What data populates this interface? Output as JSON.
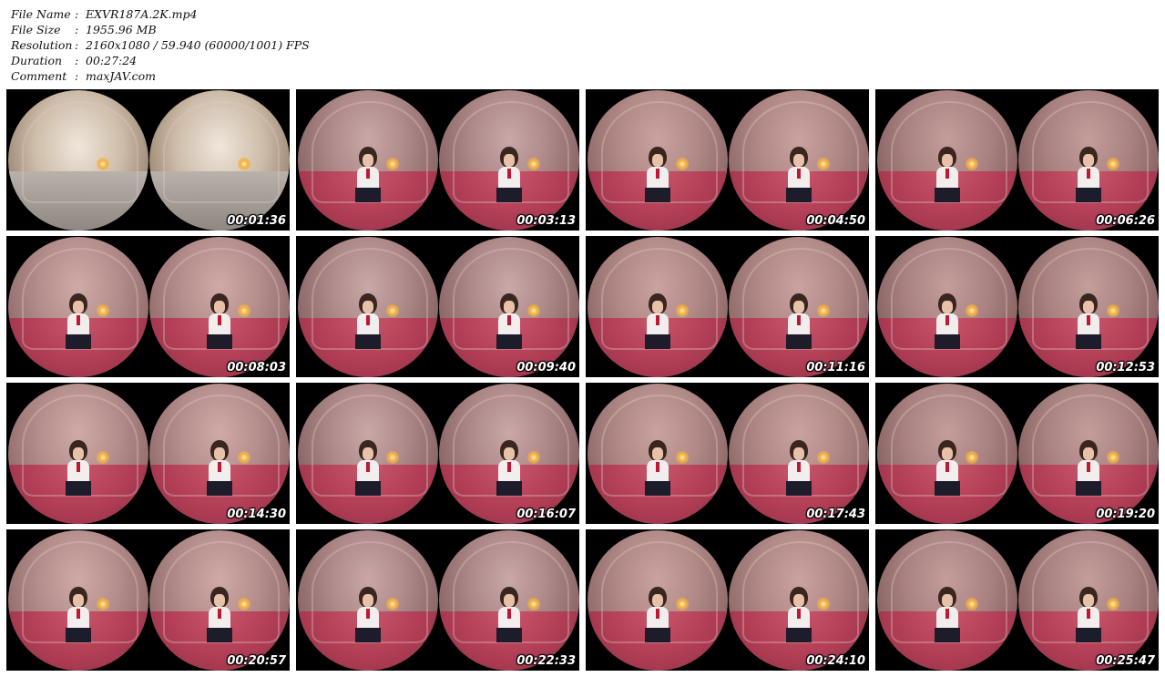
{
  "info": [
    {
      "key": "File Name",
      "sep": ":",
      "value": "EXVR187A.2K.mp4"
    },
    {
      "key": "File Size",
      "sep": ":",
      "value": "1955.96 MB"
    },
    {
      "key": "Resolution",
      "sep": ":",
      "value": "2160x1080 / 59.940 (60000/1001) FPS"
    },
    {
      "key": "Duration",
      "sep": ":",
      "value": "00:27:24"
    },
    {
      "key": "Comment",
      "sep": ":",
      "value": "maxJAV.com"
    }
  ],
  "thumbnails": [
    {
      "time": "00:01:36"
    },
    {
      "time": "00:03:13"
    },
    {
      "time": "00:04:50"
    },
    {
      "time": "00:06:26"
    },
    {
      "time": "00:08:03"
    },
    {
      "time": "00:09:40"
    },
    {
      "time": "00:11:16"
    },
    {
      "time": "00:12:53"
    },
    {
      "time": "00:14:30"
    },
    {
      "time": "00:16:07"
    },
    {
      "time": "00:17:43"
    },
    {
      "time": "00:19:20"
    },
    {
      "time": "00:20:57"
    },
    {
      "time": "00:22:33"
    },
    {
      "time": "00:24:10"
    },
    {
      "time": "00:25:47"
    }
  ]
}
